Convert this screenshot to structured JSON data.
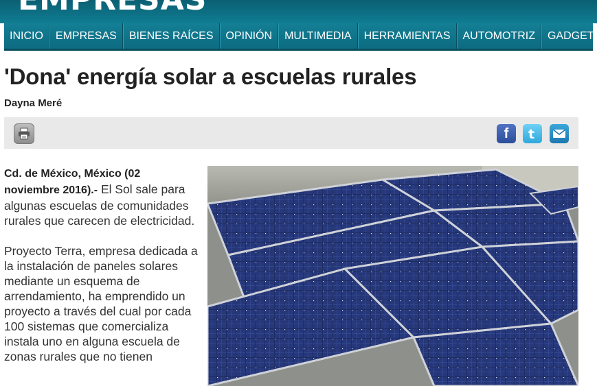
{
  "header": {
    "masthead": "EMPRESAS"
  },
  "nav": {
    "items": [
      "INICIO",
      "EMPRESAS",
      "BIENES RAÍCES",
      "OPINIÓN",
      "MULTIMEDIA",
      "HERRAMIENTAS",
      "AUTOMOTRIZ",
      "GADGETS"
    ]
  },
  "article": {
    "title": "'Dona' energía solar a escuelas rurales",
    "author": "Dayna Meré",
    "lead": "Cd. de México, México (02 noviembre 2016).-",
    "p1": "El Sol sale para algunas escuelas de comunidades rurales que carecen de electricidad.",
    "p2": "Proyecto Terra, empresa dedicada a la instalación de paneles solares mediante un esquema de arrendamiento, ha emprendido un proyecto a través del cual por cada 100 sistemas que comercializa instala uno en alguna escuela de zonas rurales que no tienen"
  },
  "toolbar": {
    "print_icon": "printer-icon",
    "share_icons": [
      "facebook-icon",
      "twitter-icon",
      "email-icon"
    ]
  },
  "colors": {
    "nav_bg": "#0d6b80",
    "masthead_bg": "#0b5f72",
    "toolbar_bg": "#e9e9e9"
  }
}
